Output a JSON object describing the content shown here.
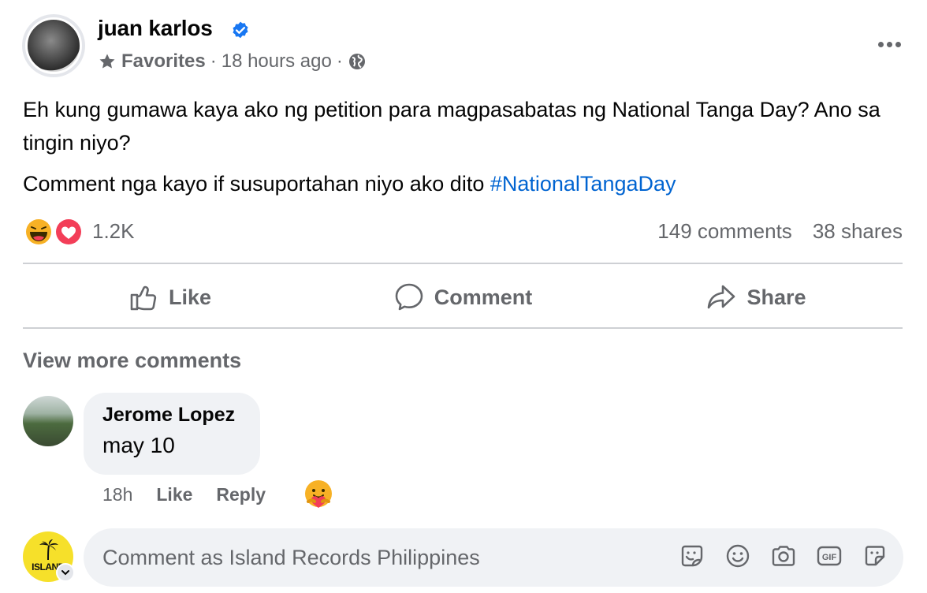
{
  "post": {
    "author": "juan karlos",
    "group": "Favorites",
    "separator": "·",
    "time": "18 hours ago",
    "verified": true,
    "text_line1": "Eh kung gumawa kaya ako ng petition para magpasabatas ng National Tanga Day? Ano sa tingin niyo?",
    "text_line2_prefix": "Comment nga kayo if susuportahan niyo ako dito ",
    "hashtag": "#NationalTangaDay"
  },
  "stats": {
    "reactions_count": "1.2K",
    "comments": "149 comments",
    "shares": "38 shares",
    "reaction_icons": [
      "haha-icon",
      "love-icon"
    ]
  },
  "actions": {
    "like": "Like",
    "comment": "Comment",
    "share": "Share"
  },
  "comments_section": {
    "view_more": "View more comments",
    "items": [
      {
        "author": "Jerome Lopez",
        "text": "may 10",
        "time": "18h",
        "like": "Like",
        "reply": "Reply",
        "reaction_icon": "care-icon"
      }
    ]
  },
  "composer": {
    "placeholder": "Comment as Island Records Philippines",
    "avatar_logo_text": "ISLAND",
    "icons": [
      "sticker-icon",
      "emoji-icon",
      "camera-icon",
      "gif-icon",
      "avatar-sticker-icon"
    ]
  },
  "colors": {
    "link": "#0064d1",
    "secondary_text": "#65676b",
    "bubble_bg": "#f0f2f5",
    "verified_blue": "#1877f2",
    "love_red": "#f33e58",
    "haha_yellow": "#f7b125"
  }
}
